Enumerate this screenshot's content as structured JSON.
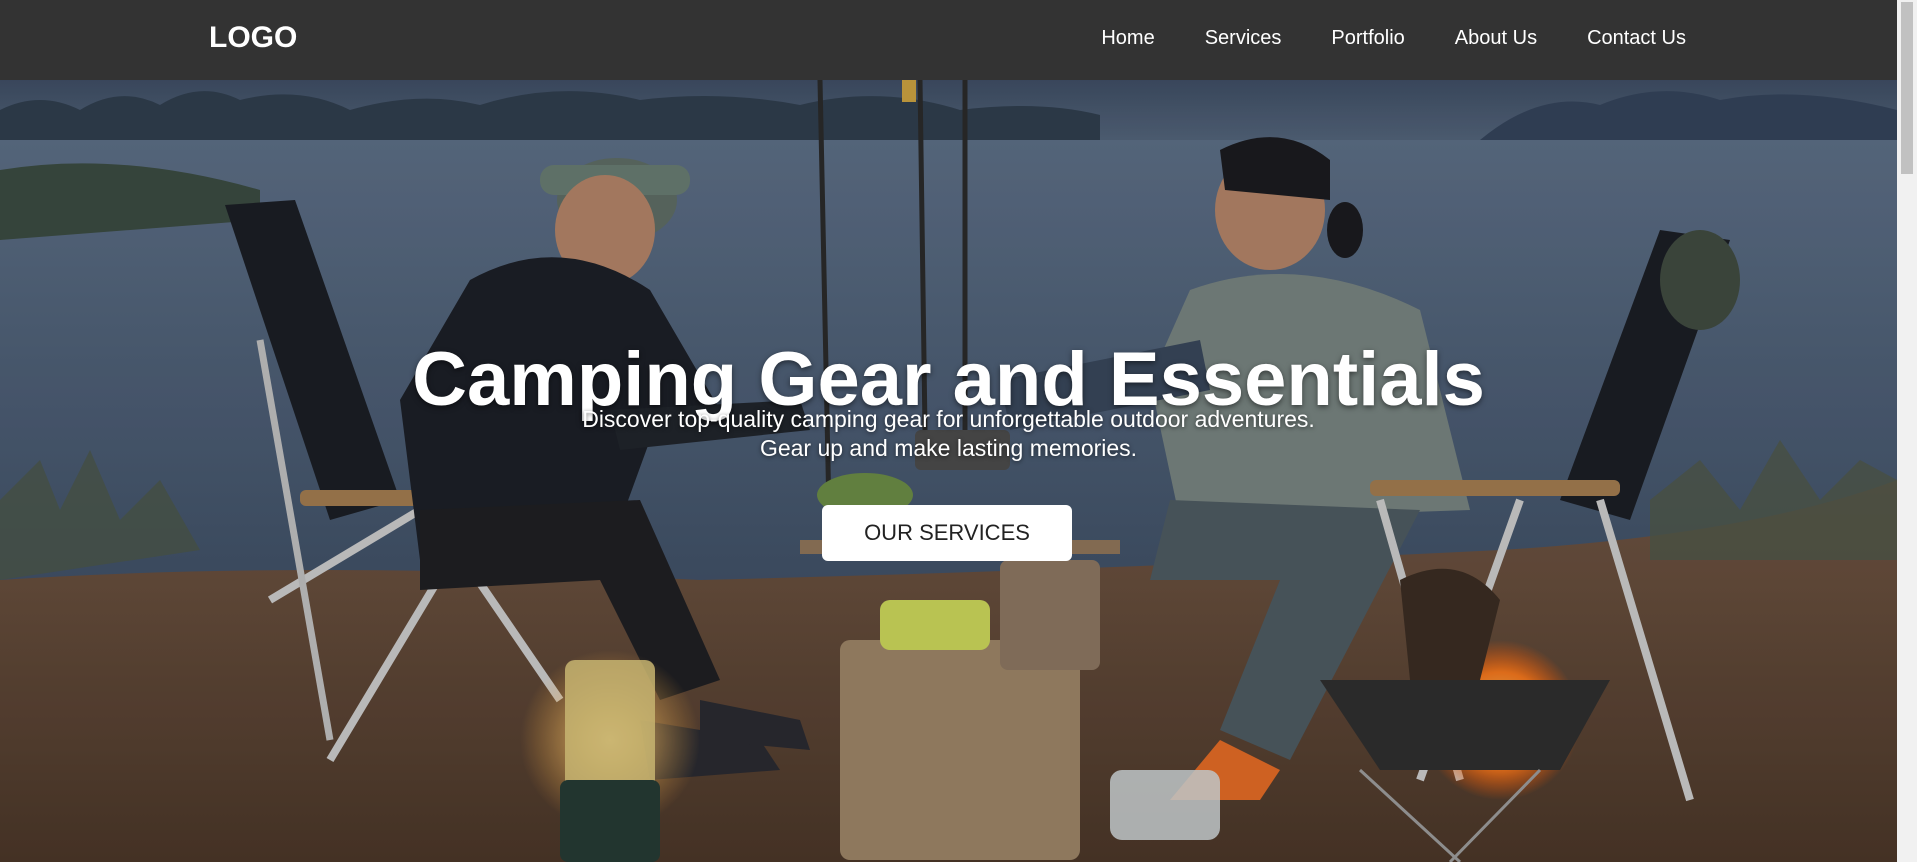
{
  "header": {
    "logo": "LOGO",
    "nav": [
      {
        "label": "Home"
      },
      {
        "label": "Services"
      },
      {
        "label": "Portfolio"
      },
      {
        "label": "About Us"
      },
      {
        "label": "Contact Us"
      }
    ]
  },
  "hero": {
    "title": "Camping Gear and Essentials",
    "subtitle_line1": "Discover top-quality camping gear for unforgettable outdoor adventures.",
    "subtitle_line2": "Gear up and make lasting memories.",
    "cta_label": "OUR SERVICES"
  },
  "colors": {
    "header_bg": "#333333",
    "nav_text": "#ffffff",
    "cta_bg": "#ffffff",
    "cta_text": "#222222"
  }
}
